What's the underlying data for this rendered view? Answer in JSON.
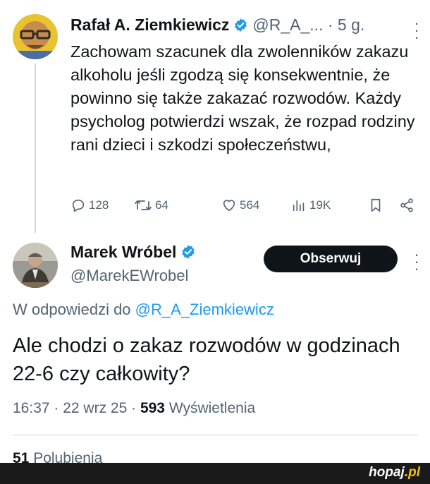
{
  "tweet1": {
    "author_name": "Rafał A. Ziemkiewicz",
    "handle": "@R_A_...",
    "time": "· 5 g.",
    "text": "Zachowam szacunek dla zwolenników zakazu alkoholu jeśli zgodzą się konsekwentnie, że powinno się także zakazać rozwodów. Każdy psycholog potwierdzi wszak, że rozpad rodziny rani dzieci i szkodzi społeczeństwu,",
    "replies": "128",
    "reposts": "64",
    "likes": "564",
    "views": "19K"
  },
  "tweet2": {
    "author_name": "Marek Wróbel",
    "handle": "@MarekEWrobel",
    "follow_label": "Obserwuj",
    "reply_prefix": "W odpowiedzi do",
    "reply_mention": "@R_A_Ziemkiewicz",
    "text": "Ale chodzi o zakaz rozwodów w godzinach 22-6 czy całkowity?",
    "time": "16:37 · 22 wrz 25 ·",
    "views_count": "593",
    "views_label": "Wyświetlenia",
    "likes_count": "51",
    "likes_label": "Polubienia"
  },
  "watermark": {
    "prefix": "hopaj",
    "suffix": ".pl"
  },
  "colors": {
    "verified": "#1d9bf0",
    "text": "#0f1419",
    "muted": "#536471",
    "link": "#1d9bf0"
  }
}
